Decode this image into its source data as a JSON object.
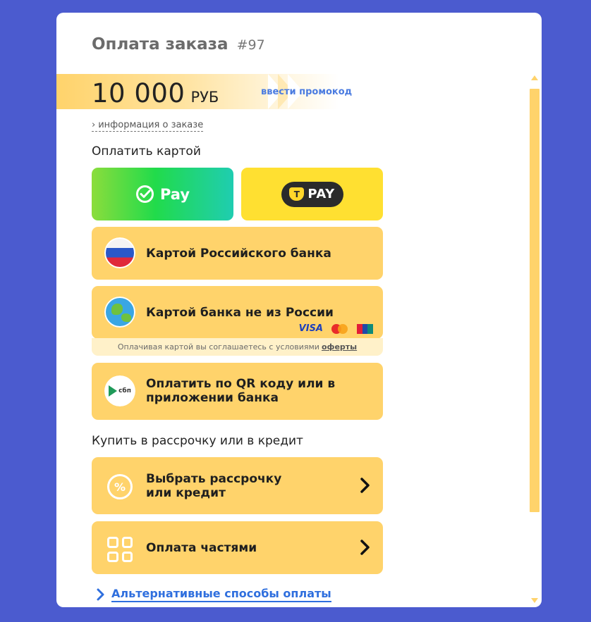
{
  "header": {
    "title": "Оплата заказа",
    "order_number": "#97"
  },
  "amount": {
    "value": "10 000",
    "currency": "РУБ",
    "promo_link": "ввести промокод"
  },
  "info_link": {
    "label": "информация о заказе",
    "chevron": "›"
  },
  "sections": {
    "pay_by_card": "Оплатить картой",
    "installment": "Купить в рассрочку или в кредит"
  },
  "quick_pay": {
    "sber": {
      "label": "Pay",
      "icon": "sber-check-icon"
    },
    "tpay": {
      "badge": "T",
      "label": "PAY"
    }
  },
  "methods": {
    "russian_bank": {
      "label": "Картой Российского банка",
      "icon": "russia-flag-icon"
    },
    "foreign_bank": {
      "label": "Картой банка не из России",
      "icon": "globe-icon",
      "logos": {
        "visa": "VISA"
      }
    },
    "oferta": {
      "text": "Оплачивая картой вы соглашаетесь с условиями",
      "link": "оферты"
    },
    "sbp": {
      "label_line1": "Оплатить по QR коду или в",
      "label_line2": "приложении банка",
      "icon_text": "сбп"
    },
    "installment": {
      "label_line1": "Выбрать рассрочку",
      "label_line2": "или кредит",
      "icon_text": "%"
    },
    "parts": {
      "label": "Оплата частями"
    }
  },
  "alt_link": {
    "label": "Альтернативные способы оплаты"
  },
  "colors": {
    "background": "#4b5bcf",
    "accent": "#ffd36b",
    "link": "#2f6fde",
    "sber": "#21db4b",
    "tpay": "#ffe031"
  }
}
